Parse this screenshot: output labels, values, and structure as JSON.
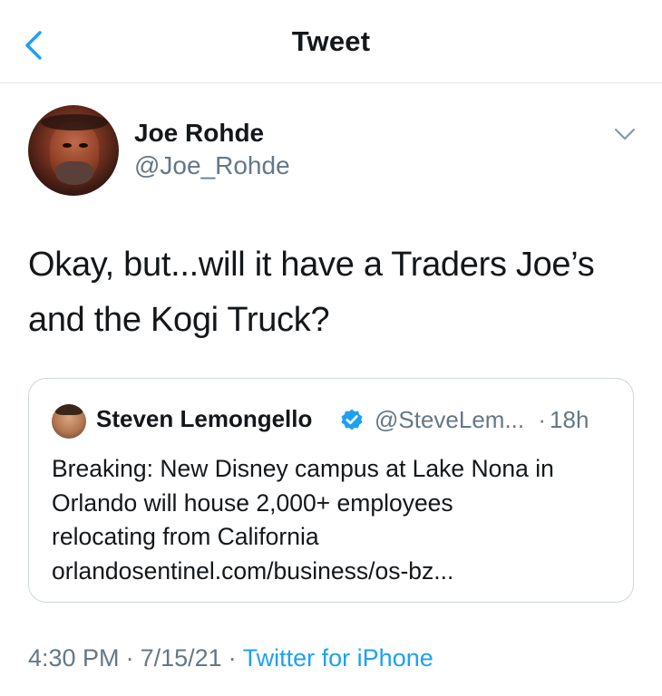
{
  "header": {
    "title": "Tweet",
    "back_icon": "chevron-left-icon",
    "accent_color": "#1da1f2"
  },
  "tweet": {
    "author_name": "Joe Rohde",
    "author_handle": "@Joe_Rohde",
    "text_line1": "Okay, but...will it have a Traders Joe’s",
    "text_line2": "and the Kogi Truck?",
    "menu_icon": "chevron-down-icon"
  },
  "quoted_tweet": {
    "author_name": "Steven Lemongello",
    "verified": true,
    "author_handle": "@SteveLem...",
    "time_sep": "·",
    "age": "18h",
    "line1": "Breaking: New Disney campus at Lake Nona in",
    "line2": "Orlando will house 2,000+ employees",
    "line3": "relocating from California",
    "line4": "orlandosentinel.com/business/os-bz..."
  },
  "meta": {
    "time": "4:30 PM",
    "sep1": "·",
    "date": "7/15/21",
    "sep2": "·",
    "source": "Twitter for iPhone"
  }
}
